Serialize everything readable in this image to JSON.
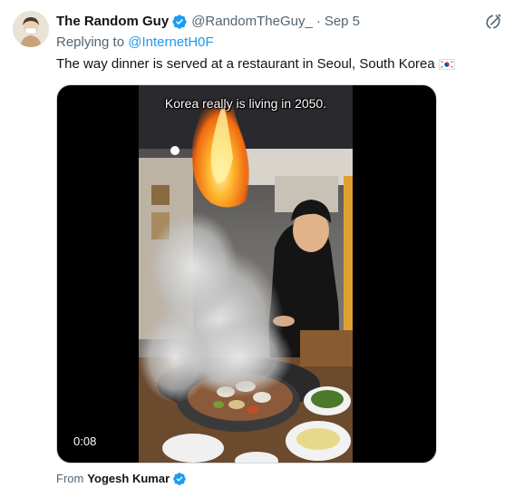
{
  "tweet": {
    "author": {
      "display_name": "The Random Guy",
      "handle": "@RandomTheGuy_",
      "verified": true
    },
    "separator": "·",
    "date": "Sep 5",
    "replying_prefix": "Replying to",
    "replying_to": "@InternetH0F",
    "text": "The way dinner is served at a restaurant in Seoul, South Korea",
    "flag_icon": "south-korea-flag-icon",
    "media": {
      "type": "video",
      "overlay_caption": "Korea really is living in 2050.",
      "duration": "0:08"
    },
    "source": {
      "prefix": "From",
      "name": "Yogesh Kumar",
      "verified": true
    }
  },
  "icons": {
    "verified": "verified-badge-icon",
    "grok": "grok-icon"
  },
  "colors": {
    "accent": "#1d9bf0",
    "secondary_text": "#536471",
    "primary_text": "#0f1419"
  }
}
